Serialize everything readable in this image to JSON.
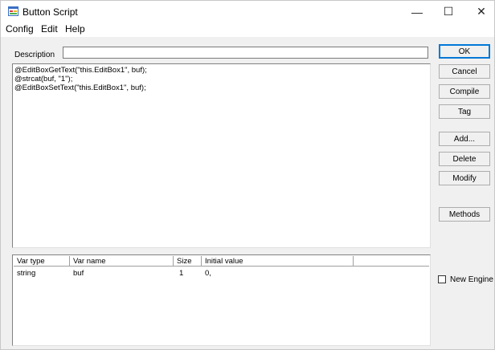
{
  "window": {
    "title": "Button Script",
    "controls": {
      "minimize": "—",
      "maximize": "☐",
      "close": "✕"
    }
  },
  "menu": [
    "Config",
    "Edit",
    "Help"
  ],
  "description": {
    "label": "Description",
    "value": ""
  },
  "script_lines": [
    "@EditBoxGetText(\"this.EditBox1\", buf);",
    "@strcat(buf, \"1\");",
    "@EditBoxSetText(\"this.EditBox1\", buf);"
  ],
  "var_table": {
    "columns": [
      "Var type",
      "Var name",
      "Size",
      "Initial value",
      ""
    ],
    "rows": [
      {
        "type": "string",
        "name": "buf",
        "size": "1",
        "initial": "0,"
      }
    ]
  },
  "buttons": {
    "ok": "OK",
    "cancel": "Cancel",
    "compile": "Compile",
    "tag": "Tag",
    "add": "Add...",
    "delete": "Delete",
    "modify": "Modify",
    "methods": "Methods"
  },
  "new_engine": {
    "label": "New Engine",
    "checked": false
  }
}
